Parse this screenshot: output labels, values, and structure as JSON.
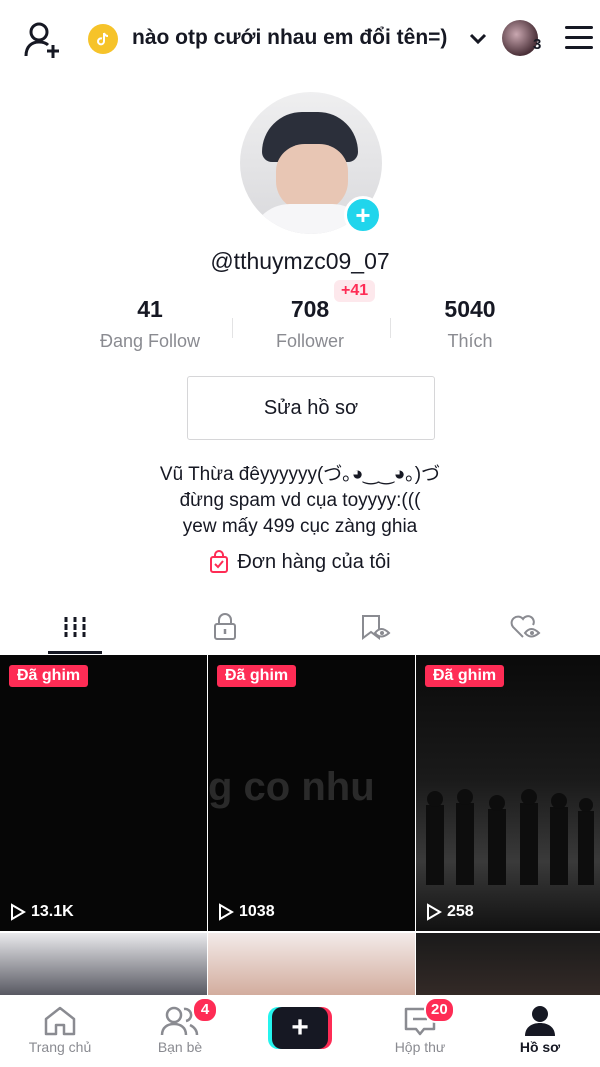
{
  "header": {
    "username": "nào otp cưới nhau em đổi tên=)",
    "account_count": "3"
  },
  "profile": {
    "handle": "@tthuymzc09_07",
    "new_followers_badge": "+41",
    "stats": [
      {
        "value": "41",
        "label": "Đang Follow"
      },
      {
        "value": "708",
        "label": "Follower"
      },
      {
        "value": "5040",
        "label": "Thích"
      }
    ],
    "edit_label": "Sửa hồ sơ",
    "bio": [
      "Vũ Thừa đêyyyyyy(づ｡◕‿‿◕｡)づ",
      "đừng spam vd cụa toyyyy:(((",
      "yew mấy 499 cục zàng ghia"
    ],
    "orders_label": "Đơn hàng của tôi"
  },
  "tabs": [
    {
      "icon": "grid-icon",
      "active": true
    },
    {
      "icon": "lock-icon",
      "active": false
    },
    {
      "icon": "bookmark-eye-icon",
      "active": false
    },
    {
      "icon": "heart-eye-icon",
      "active": false
    }
  ],
  "videos": [
    {
      "pinned_label": "Đã ghim",
      "views": "13.1K"
    },
    {
      "pinned_label": "Đã ghim",
      "views": "1038",
      "overlay_text": "g co nhu"
    },
    {
      "pinned_label": "Đã ghim",
      "views": "258"
    }
  ],
  "nav": [
    {
      "label": "Trang chủ",
      "icon": "home-icon"
    },
    {
      "label": "Bạn bè",
      "icon": "friends-icon",
      "badge": "4"
    },
    {
      "label": "",
      "icon": "create-icon"
    },
    {
      "label": "Hộp thư",
      "icon": "inbox-icon",
      "badge": "20"
    },
    {
      "label": "Hồ sơ",
      "icon": "profile-icon"
    }
  ],
  "colors": {
    "accent": "#fe2c55",
    "cyan": "#20d5ec",
    "text": "#161823",
    "muted": "#8a8b91"
  }
}
